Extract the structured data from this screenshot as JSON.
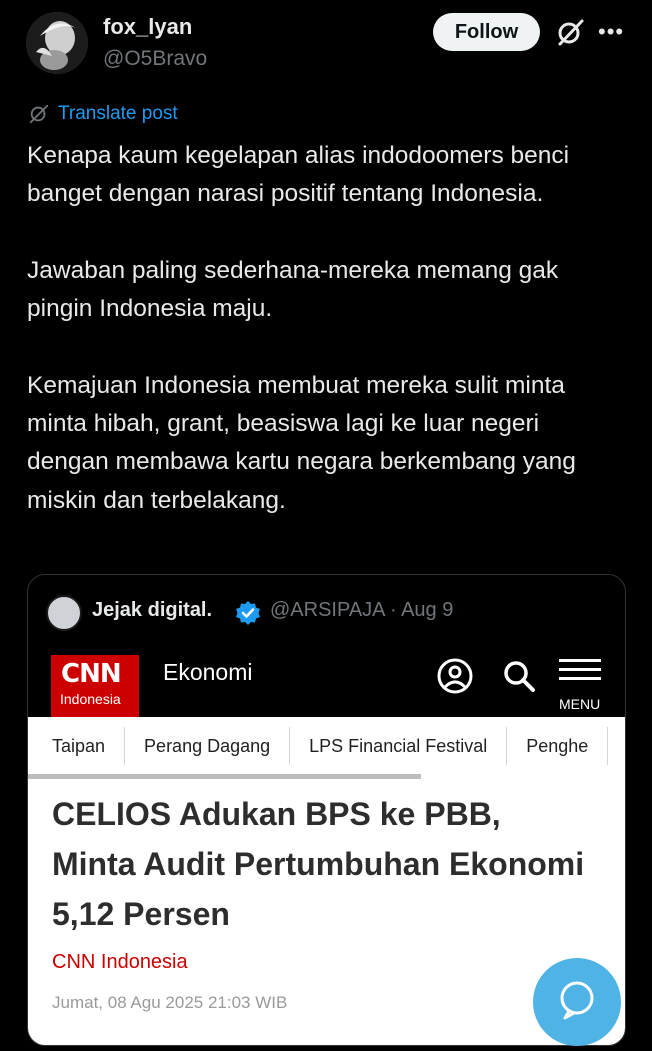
{
  "author": {
    "display_name": "fox_lyan",
    "handle": "@O5Bravo",
    "follow_label": "Follow",
    "more_label": "•••"
  },
  "translate_label": "Translate post",
  "post_text": "Kenapa kaum kegelapan alias indodoomers benci banget dengan narasi positif tentang Indonesia.\n\nJawaban paling sederhana-mereka memang gak pingin Indonesia maju.\n\nKemajuan Indonesia membuat mereka sulit minta minta hibah, grant, beasiswa lagi ke luar negeri dengan membawa kartu negara berkembang yang miskin dan terbelakang.",
  "quote": {
    "name": "Jejak digital.",
    "handle_date": "@ARSIPAJA · Aug 9",
    "cnn": {
      "logo_text": "CNN",
      "logo_sub": "Indonesia",
      "section": "Ekonomi",
      "menu_label": "MENU",
      "tabs": [
        "Taipan",
        "Perang Dagang",
        "LPS Financial Festival",
        "Penghe"
      ],
      "headline": "CELIOS Adukan BPS ke PBB, Minta Audit Pertumbuhan Ekonomi 5,12 Persen",
      "source": "CNN Indonesia",
      "date": "Jumat, 08 Agu 2025 21:03 WIB"
    }
  },
  "colors": {
    "accent": "#1d9bf0",
    "cnn_red": "#cc0000",
    "fab": "#4fb3e6"
  }
}
